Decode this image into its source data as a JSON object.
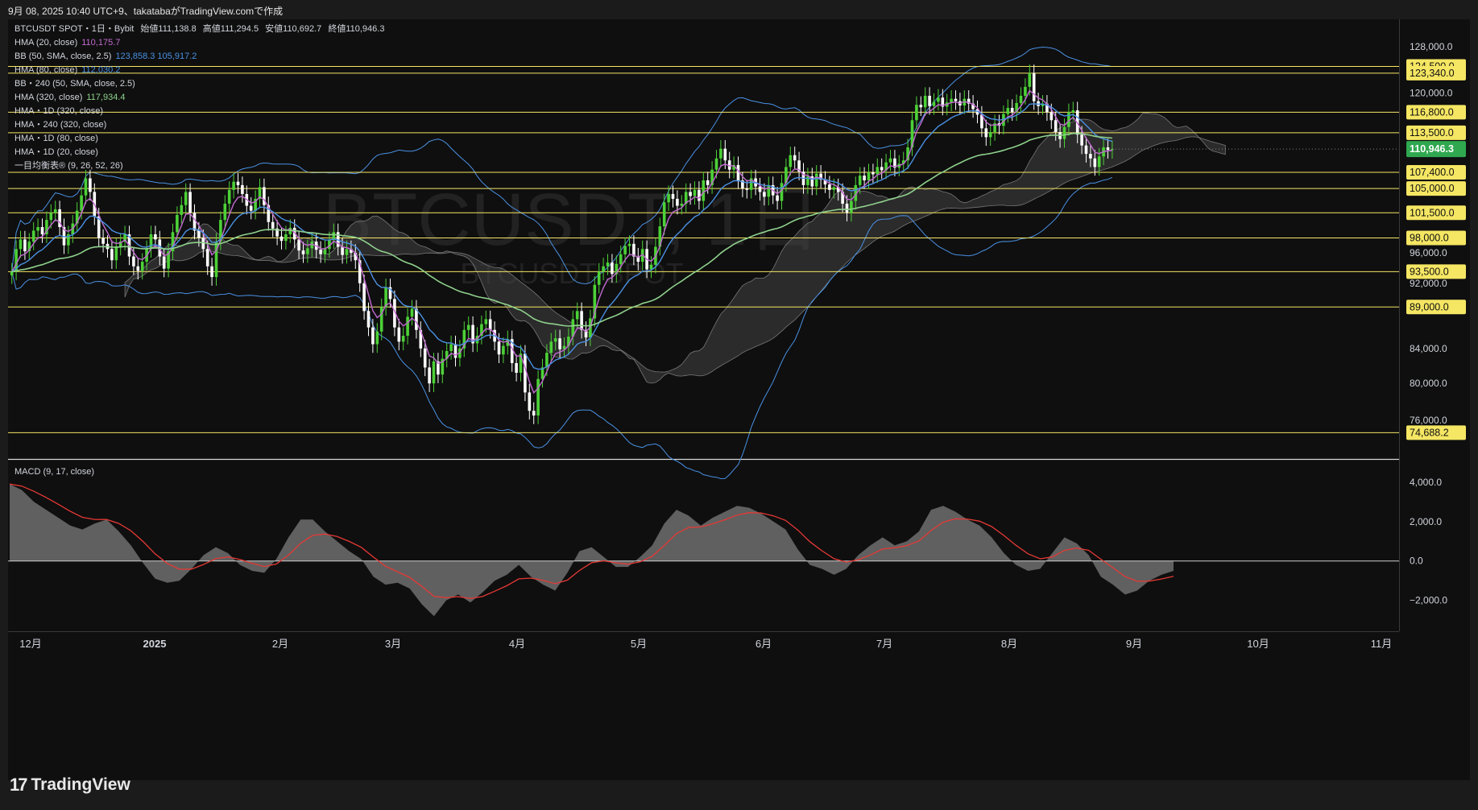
{
  "header": {
    "created_text": "9月 08, 2025 10:40 UTC+9、takatabaがTradingView.comで作成"
  },
  "legend": {
    "symbol": "BTCUSDT SPOT・1日・Bybit",
    "open_label": "始値",
    "open_value": "111,138.8",
    "high_label": "高値",
    "high_value": "111,294.5",
    "low_label": "安値",
    "low_value": "110,692.7",
    "close_label": "終値",
    "close_value": "110,946.3",
    "indicators": [
      {
        "name": "HMA (20, close)",
        "value": "110,175.7",
        "color": "#c26bd1"
      },
      {
        "name": "BB (50, SMA, close, 2.5)",
        "value": "123,858.3  105,917.2",
        "color": "#4a90e2"
      },
      {
        "name": "HMA (80, close)",
        "value": "112,030.2",
        "color": "#4a90e2"
      },
      {
        "name": "BB・240 (50, SMA, close, 2.5)",
        "value": "",
        "color": "#d1d4dc"
      },
      {
        "name": "HMA (320, close)",
        "value": "117,934.4",
        "color": "#8fd18c"
      },
      {
        "name": "HMA・1D (320, close)",
        "value": "",
        "color": "#d1d4dc"
      },
      {
        "name": "HMA・240 (320, close)",
        "value": "",
        "color": "#d1d4dc"
      },
      {
        "name": "HMA・1D (80, close)",
        "value": "",
        "color": "#d1d4dc"
      },
      {
        "name": "HMA・1D (20, close)",
        "value": "",
        "color": "#d1d4dc"
      },
      {
        "name": "一目均衡表® (9, 26, 52, 26)",
        "value": "",
        "color": "#d1d4dc"
      }
    ],
    "macd_label": "MACD (9, 17, close)"
  },
  "watermark": {
    "big": "BTCUSDT, 1日",
    "small": "BTCUSDT SPOT"
  },
  "brand": {
    "name": "TradingView",
    "logo": "17"
  },
  "colors": {
    "bg": "#0f0f0f",
    "up": "#4cd137",
    "down": "#ffffff",
    "level": "#f5e663",
    "last_price": "#2fa84f",
    "hma20": "#c26bd1",
    "hma80": "#4a90e2",
    "hma320": "#8fd18c",
    "bb": "#4a90e2",
    "cloud": "#444444",
    "macd_hist": "#6e6e6e",
    "macd_signal": "#e53935"
  },
  "chart_data": [
    {
      "type": "candlestick",
      "title": "BTCUSDT SPOT・1日・Bybit",
      "x_ticks": [
        "12月",
        "2025",
        "2月",
        "3月",
        "4月",
        "5月",
        "6月",
        "7月",
        "8月",
        "9月",
        "10月",
        "11月"
      ],
      "y_ticks": [
        "128,000.0",
        "120,000.0",
        "96,000.0",
        "92,000.0",
        "84,000.0",
        "80,000.0",
        "76,000.0"
      ],
      "y_scale": "log",
      "ylim": [
        72000,
        130000
      ],
      "horizontal_levels": [
        "124,500.0",
        "123,340.0",
        "116,800.0",
        "113,500.0",
        "107,400.0",
        "105,000.0",
        "101,500.0",
        "98,000.0",
        "93,500.0",
        "89,000.0",
        "74,688.2"
      ],
      "last_price": "110,946.3",
      "last_ohlc": {
        "open": 111138.8,
        "high": 111294.5,
        "low": 110692.7,
        "close": 110946.3
      },
      "approx_daily_closes": [
        93500,
        96500,
        97800,
        96200,
        97500,
        99000,
        99500,
        98500,
        100500,
        101500,
        102000,
        99500,
        97000,
        98500,
        100000,
        101800,
        104000,
        106500,
        104500,
        101000,
        98000,
        97200,
        96500,
        95000,
        96800,
        97500,
        98500,
        95500,
        94200,
        93600,
        94800,
        96500,
        98500,
        97800,
        95500,
        93900,
        96200,
        98800,
        101200,
        102600,
        104500,
        101500,
        99000,
        98000,
        96500,
        94200,
        92800,
        97500,
        100500,
        102800,
        104800,
        106000,
        105500,
        104200,
        102500,
        101800,
        103500,
        105200,
        102600,
        100200,
        99300,
        98200,
        97600,
        98500,
        99400,
        97800,
        96300,
        95800,
        96600,
        97500,
        96400,
        95800,
        96500,
        97700,
        98800,
        96800,
        95700,
        96500,
        96000,
        95000,
        92000,
        88500,
        86500,
        84500,
        86000,
        89000,
        91500,
        90000,
        86500,
        84800,
        85500,
        87800,
        88800,
        86200,
        84000,
        81800,
        80000,
        82500,
        81000,
        82800,
        83700,
        84500,
        82900,
        84000,
        86200,
        86800,
        84600,
        85500,
        86900,
        87500,
        86200,
        84800,
        83300,
        84300,
        85100,
        82300,
        81200,
        83400,
        79000,
        77000,
        76500,
        80500,
        81800,
        83500,
        84800,
        85200,
        83900,
        84300,
        85400,
        87500,
        88500,
        86200,
        85300,
        87600,
        91800,
        93500,
        94200,
        94700,
        93200,
        94500,
        95800,
        96900,
        97200,
        95500,
        94800,
        96500,
        93800,
        94400,
        96800,
        99600,
        103000,
        104200,
        103500,
        102500,
        102800,
        104500,
        103900,
        104800,
        103200,
        106200,
        105500,
        107800,
        109500,
        111000,
        109200,
        107800,
        108500,
        106200,
        105000,
        104800,
        106500,
        105300,
        104500,
        103800,
        105500,
        104000,
        103200,
        105800,
        108200,
        110000,
        109200,
        107500,
        105500,
        106800,
        105300,
        107200,
        106300,
        105600,
        104800,
        105200,
        104500,
        102800,
        101500,
        103200,
        105500,
        106900,
        106200,
        107400,
        107100,
        108200,
        107700,
        108900,
        109500,
        108100,
        108700,
        109200,
        111200,
        115500,
        118000,
        117600,
        119500,
        117800,
        118500,
        119200,
        117700,
        118400,
        119000,
        118600,
        117900,
        119000,
        118200,
        117300,
        116400,
        114200,
        112800,
        113600,
        115000,
        114600,
        116500,
        117500,
        116800,
        118300,
        119500,
        121000,
        123340,
        118600,
        117800,
        118200,
        116800,
        115500,
        113600,
        112500,
        114400,
        116800,
        117100,
        113200,
        111500,
        110200,
        109500,
        108200,
        109800,
        111200,
        110800,
        110946
      ]
    },
    {
      "type": "bar",
      "title": "MACD (9, 17, close)",
      "y_ticks": [
        "4,000.0",
        "2,000.0",
        "0.0",
        "-2,000.0"
      ],
      "ylim": [
        -3400,
        4400
      ],
      "approx_hist": [
        3900,
        3600,
        3000,
        2600,
        2200,
        1800,
        1600,
        1900,
        2100,
        1500,
        800,
        -100,
        -900,
        -1100,
        -1000,
        -400,
        300,
        700,
        400,
        -200,
        -500,
        -600,
        100,
        1200,
        2100,
        2100,
        1500,
        1000,
        500,
        100,
        -800,
        -1200,
        -1100,
        -1400,
        -2200,
        -2800,
        -2000,
        -1700,
        -2100,
        -1600,
        -1000,
        -700,
        -200,
        -800,
        -1200,
        -1500,
        -600,
        500,
        700,
        200,
        -300,
        -300,
        200,
        800,
        1900,
        2600,
        2300,
        1800,
        2200,
        2500,
        2800,
        2700,
        2400,
        2000,
        1600,
        600,
        -200,
        -400,
        -700,
        -400,
        300,
        800,
        1200,
        800,
        1000,
        1500,
        2600,
        2800,
        2500,
        2100,
        1800,
        1200,
        400,
        -200,
        -500,
        -400,
        400,
        1200,
        900,
        300,
        -800,
        -1200,
        -1700,
        -1500,
        -1000,
        -700,
        -500
      ]
    }
  ]
}
